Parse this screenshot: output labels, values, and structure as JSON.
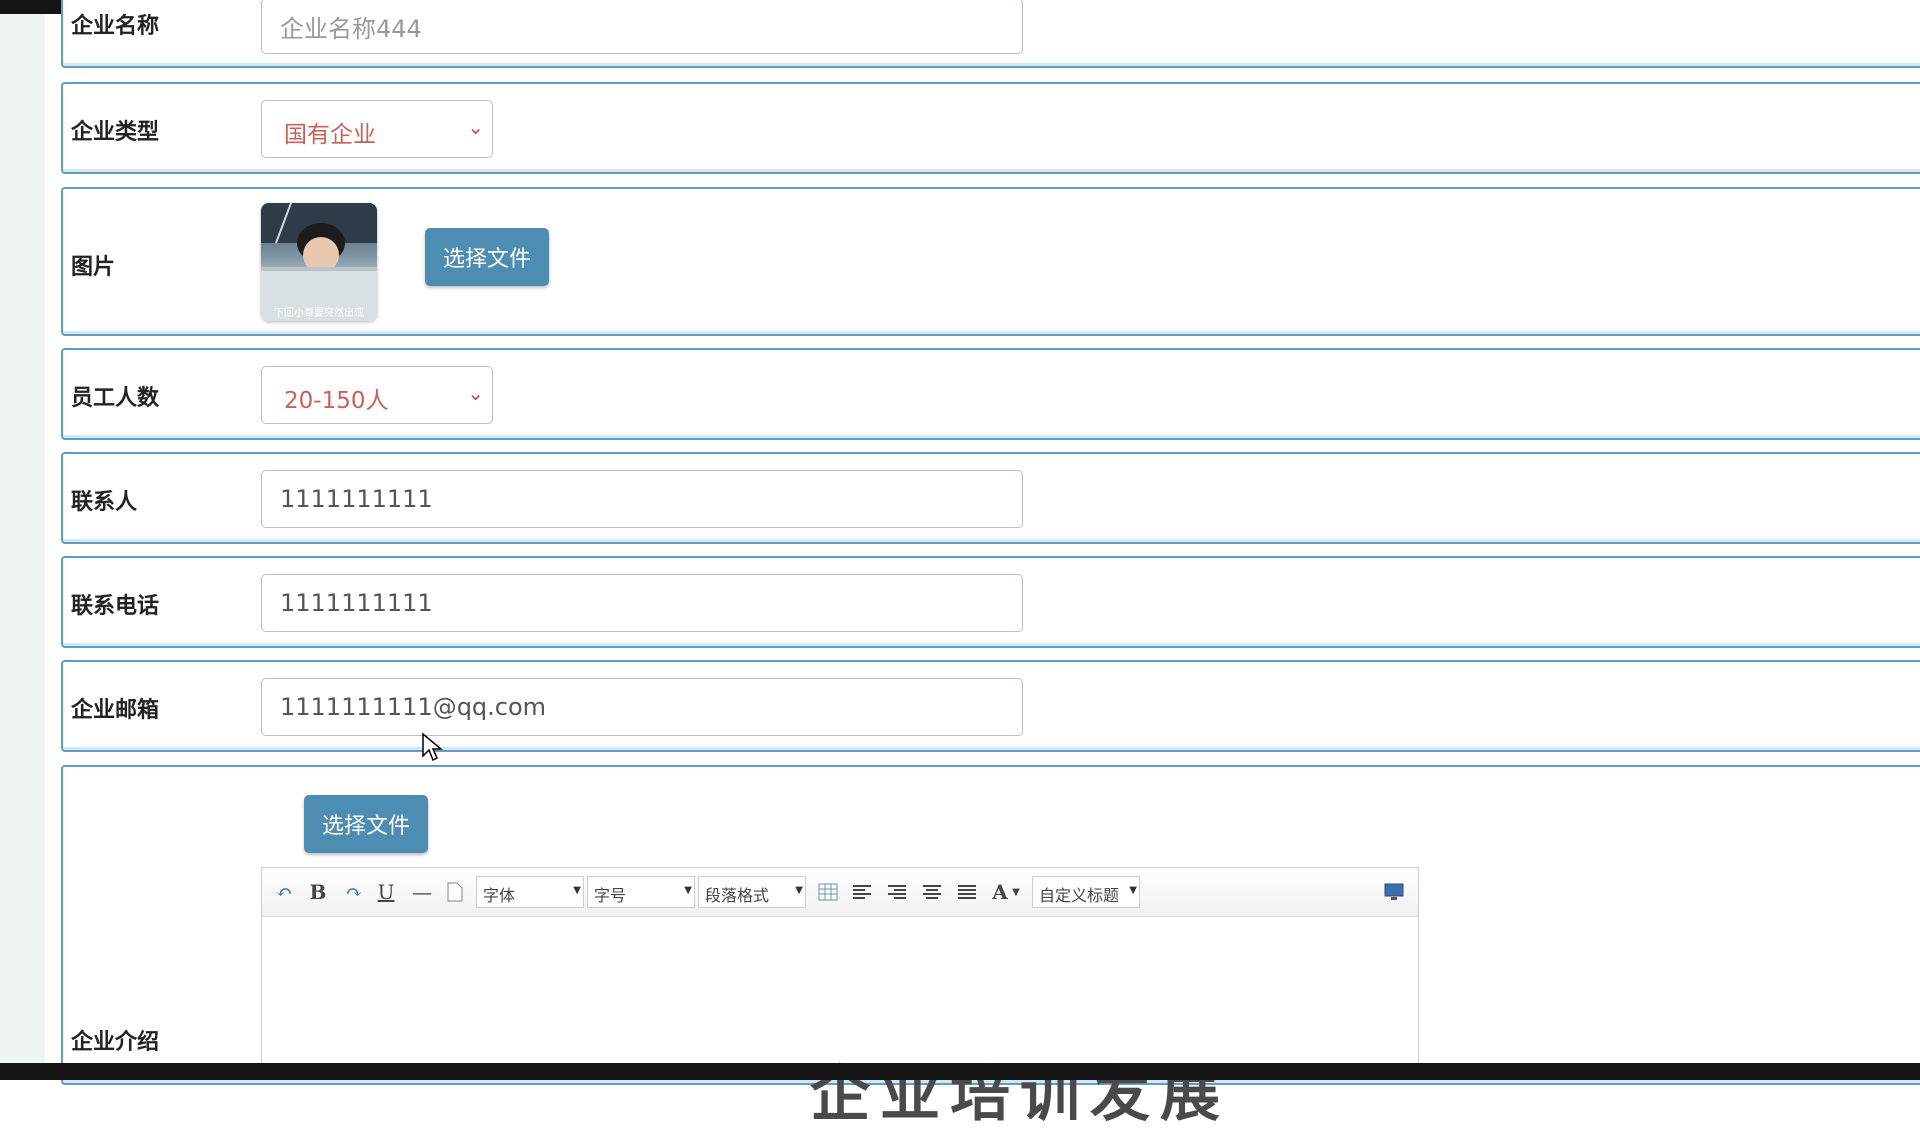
{
  "form": {
    "company_name": {
      "label": "企业名称",
      "value": "企业名称444"
    },
    "company_type": {
      "label": "企业类型",
      "value": "国有企业"
    },
    "picture": {
      "label": "图片",
      "button": "选择文件",
      "thumb_caption": "下回小哥要突然出现"
    },
    "employee_count": {
      "label": "员工人数",
      "value": "20-150人"
    },
    "contact": {
      "label": "联系人",
      "value": "1111111111"
    },
    "phone": {
      "label": "联系电话",
      "value": "1111111111"
    },
    "email": {
      "label": "企业邮箱",
      "value": "1111111111@qq.com"
    },
    "intro": {
      "label": "企业介绍",
      "button": "选择文件",
      "editor_visible_text": "企业培训发展"
    }
  },
  "editor_toolbar": {
    "bold": "B",
    "underline": "U",
    "hr": "—",
    "font_family": "字体",
    "font_size": "字号",
    "paragraph": "段落格式",
    "font_color": "A",
    "custom_title": "自定义标题"
  },
  "colors": {
    "row_border": "#5e9ec2",
    "button": "#4c8db1",
    "select_text": "#c9605a",
    "background_strip": "#eef5ef"
  }
}
